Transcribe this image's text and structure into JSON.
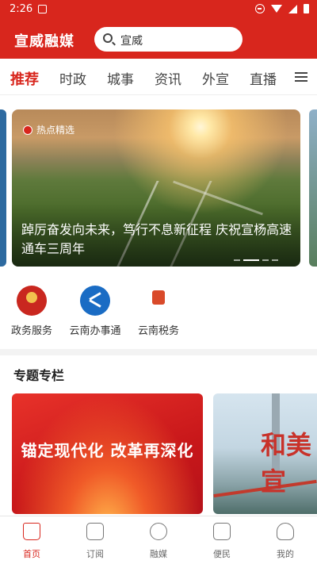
{
  "status_bar": {
    "time": "2:26"
  },
  "header": {
    "app_title": "宣威融媒",
    "search_value": "宣威"
  },
  "tabs": [
    {
      "label": "推荐",
      "active": true
    },
    {
      "label": "时政"
    },
    {
      "label": "城事"
    },
    {
      "label": "资讯"
    },
    {
      "label": "外宣"
    },
    {
      "label": "直播"
    }
  ],
  "banner": {
    "tag": "热点精选",
    "caption": "踔厉奋发向未来，笃行不息新征程 庆祝宣杨高速通车三周年",
    "slide_count": 4,
    "active_slide": 1
  },
  "services": [
    {
      "label": "政务服务",
      "icon": "gov-emblem-icon"
    },
    {
      "label": "云南办事通",
      "icon": "yunnan-banshitong-icon"
    },
    {
      "label": "云南税务",
      "icon": "tax-emblem-icon"
    }
  ],
  "section": {
    "title": "专题专栏"
  },
  "cards": [
    {
      "text": "锚定现代化 改革再深化"
    },
    {
      "text": "和美宣"
    }
  ],
  "bottom_nav": [
    {
      "label": "首页",
      "icon": "home-icon",
      "active": true
    },
    {
      "label": "订阅",
      "icon": "subscribe-icon"
    },
    {
      "label": "融媒",
      "icon": "media-icon"
    },
    {
      "label": "便民",
      "icon": "calendar-icon"
    },
    {
      "label": "我的",
      "icon": "profile-icon"
    }
  ],
  "colors": {
    "brand_red": "#d8261d"
  }
}
